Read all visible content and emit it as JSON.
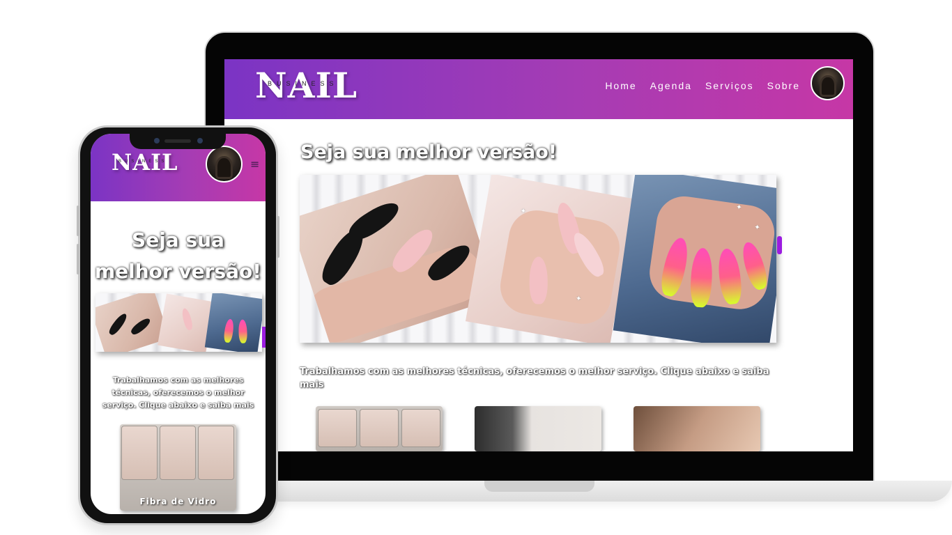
{
  "site": {
    "logo": "NAIL",
    "logo_sub": "BUSINESS",
    "nav": [
      "Home",
      "Agenda",
      "Serviços",
      "Sobre"
    ],
    "headline": "Seja sua melhor versão!",
    "intro": "Trabalhamos com as melhores técnicas, oferecemos o melhor serviço. Clique abaixo e saiba mais",
    "service_cards": [
      "Fibra de Vidro"
    ]
  },
  "phone": {
    "headline_line1": "Seja sua",
    "headline_line2": "melhor versão!",
    "menu_icon": "≡"
  },
  "colors": {
    "header_start": "#7b34c4",
    "header_end": "#c637a6",
    "accent": "#9b1be0"
  },
  "icons": {
    "menu": "hamburger-icon",
    "profile": "avatar"
  }
}
